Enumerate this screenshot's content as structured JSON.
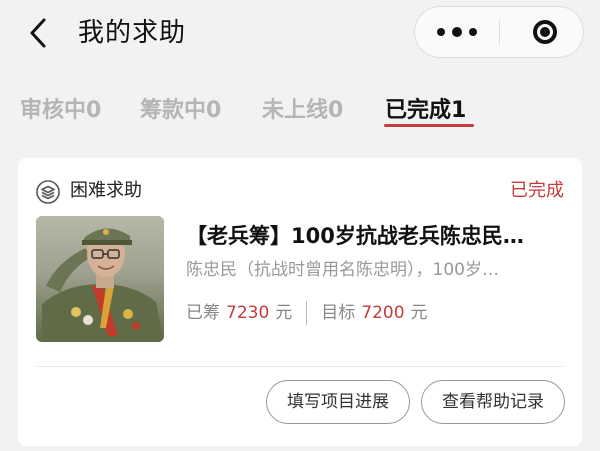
{
  "nav": {
    "title": "我的求助"
  },
  "tabs": [
    {
      "label": "审核中0"
    },
    {
      "label": "筹款中0"
    },
    {
      "label": "未上线0"
    },
    {
      "label": "已完成1",
      "active": true
    }
  ],
  "card": {
    "type_label": "困难求助",
    "type_icon": "layers-icon",
    "status": "已完成",
    "title": "【老兵筹】100岁抗战老兵陈忠民…",
    "description": "陈忠民（抗战时曾用名陈忠明），100岁…",
    "raised_label": "已筹",
    "raised_value": "7230",
    "raised_unit": "元",
    "target_label": "目标",
    "target_value": "7200",
    "target_unit": "元",
    "buttons": {
      "update": "填写项目进展",
      "records": "查看帮助记录"
    }
  },
  "colors": {
    "accent": "#c43c3c",
    "background": "#f2f2f2",
    "inactive_tab": "#b5b5b5"
  }
}
